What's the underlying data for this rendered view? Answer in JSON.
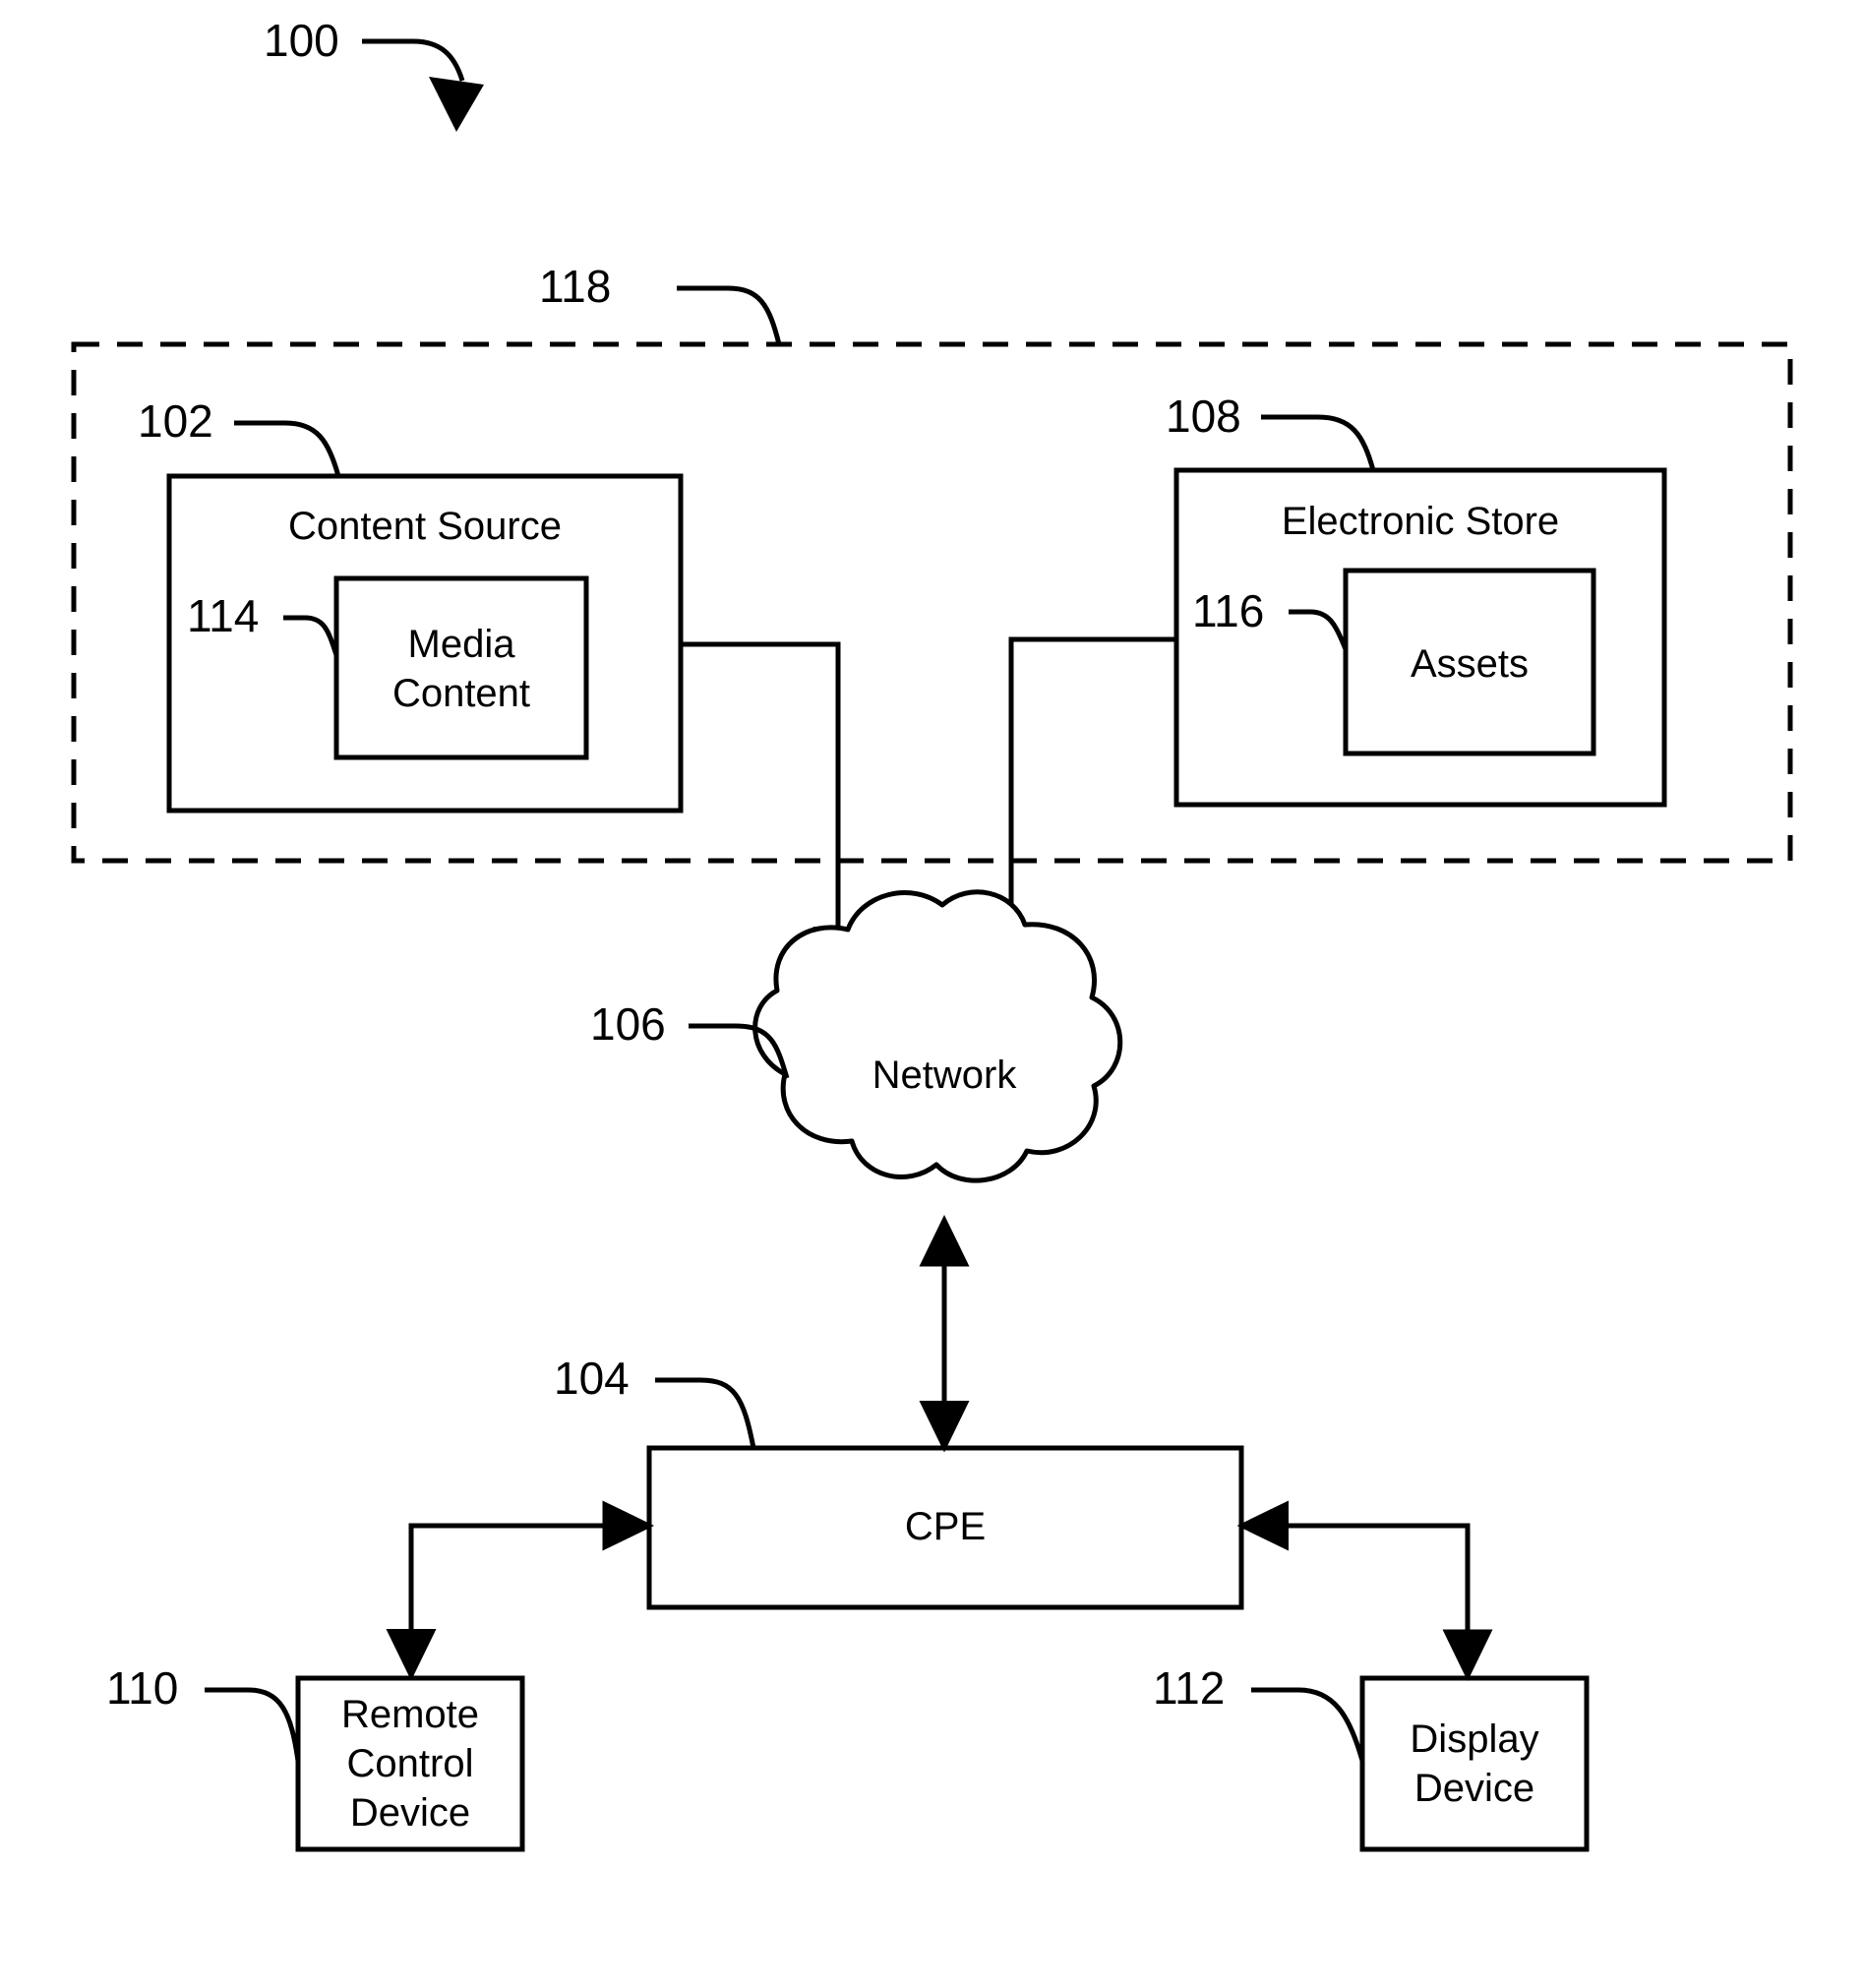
{
  "figure": {
    "figure_ref": "100",
    "system_boundary_ref": "118",
    "nodes": [
      {
        "ref": "102",
        "label": "Content Source"
      },
      {
        "ref": "114",
        "label": "Media\nContent"
      },
      {
        "ref": "108",
        "label": "Electronic Store"
      },
      {
        "ref": "116",
        "label": "Assets"
      },
      {
        "ref": "106",
        "label": "Network"
      },
      {
        "ref": "104",
        "label": "CPE"
      },
      {
        "ref": "110",
        "label": "Remote\nControl\nDevice"
      },
      {
        "ref": "112",
        "label": "Display\nDevice"
      }
    ],
    "refs": {
      "figure": "100",
      "content_source": "102",
      "cpe": "104",
      "network": "106",
      "electronic_store": "108",
      "remote_control": "110",
      "display_device": "112",
      "media_content": "114",
      "assets": "116",
      "boundary": "118"
    },
    "labels": {
      "content_source": "Content Source",
      "media_content": "Media\nContent",
      "electronic_store": "Electronic Store",
      "assets": "Assets",
      "network": "Network",
      "cpe": "CPE",
      "remote_control_device": "Remote\nControl\nDevice",
      "display_device": "Display\nDevice"
    },
    "colors": {
      "stroke": "#000000",
      "background": "#ffffff"
    },
    "connections": [
      {
        "from": "102",
        "to": "106",
        "arrow": "single"
      },
      {
        "from": "108",
        "to": "106",
        "arrow": "single"
      },
      {
        "from": "106",
        "to": "104",
        "arrow": "double"
      },
      {
        "from": "104",
        "to": "110",
        "arrow": "double"
      },
      {
        "from": "112",
        "to": "104",
        "arrow": "double"
      }
    ]
  }
}
